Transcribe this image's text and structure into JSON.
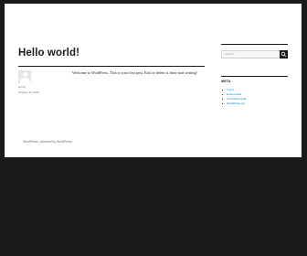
{
  "post": {
    "title": "Hello world!",
    "author": "jennyf",
    "date": "October 12, 2019",
    "content": "Welcome to WordPress. This is your first post. Edit or delete it, then start writing!"
  },
  "sidebar": {
    "search": {
      "placeholder": "Search …"
    },
    "meta": {
      "title": "META",
      "items": [
        "Log in",
        "Entries feed",
        "Comments feed",
        "WordPress.org"
      ]
    }
  },
  "footer": {
    "text": "WordPress, powered by WordPress"
  },
  "colors": {
    "background": "#1a1a1a",
    "page": "#ffffff",
    "link": "#007acc",
    "muted": "#707070"
  }
}
